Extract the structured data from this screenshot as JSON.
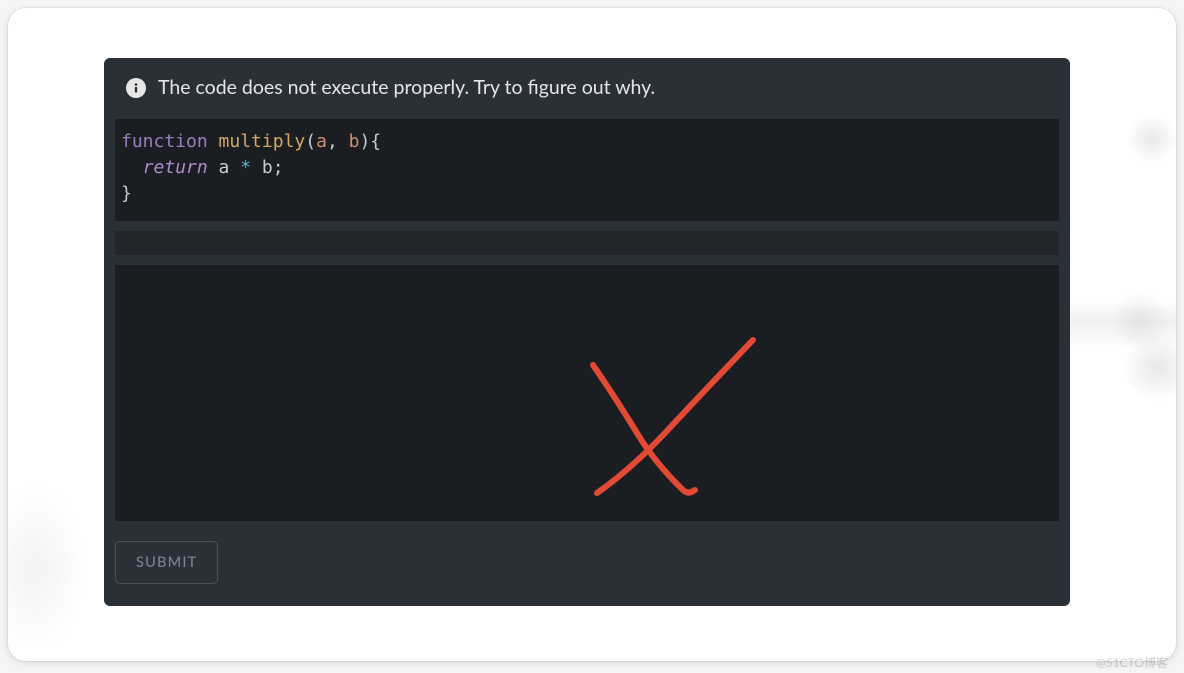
{
  "instruction": {
    "text": "The code does not execute properly. Try to figure out why."
  },
  "code": {
    "tokens": [
      {
        "t": "function",
        "c": "tok-keyword"
      },
      {
        "t": " ",
        "c": ""
      },
      {
        "t": "multiply",
        "c": "tok-func"
      },
      {
        "t": "(",
        "c": "tok-paren"
      },
      {
        "t": "a",
        "c": "tok-param"
      },
      {
        "t": ", ",
        "c": "tok-paren"
      },
      {
        "t": "b",
        "c": "tok-param"
      },
      {
        "t": "){",
        "c": "tok-paren"
      },
      {
        "t": "\n  ",
        "c": ""
      },
      {
        "t": "return",
        "c": "tok-keyword2"
      },
      {
        "t": " a ",
        "c": ""
      },
      {
        "t": "*",
        "c": "tok-op"
      },
      {
        "t": " b",
        "c": ""
      },
      {
        "t": ";",
        "c": "tok-semi"
      },
      {
        "t": "\n}",
        "c": "tok-paren"
      }
    ]
  },
  "annotation": {
    "mark": "x-cross",
    "color": "#e24a33"
  },
  "actions": {
    "submit_label": "SUBMIT"
  },
  "watermark": "@51CTO博客"
}
